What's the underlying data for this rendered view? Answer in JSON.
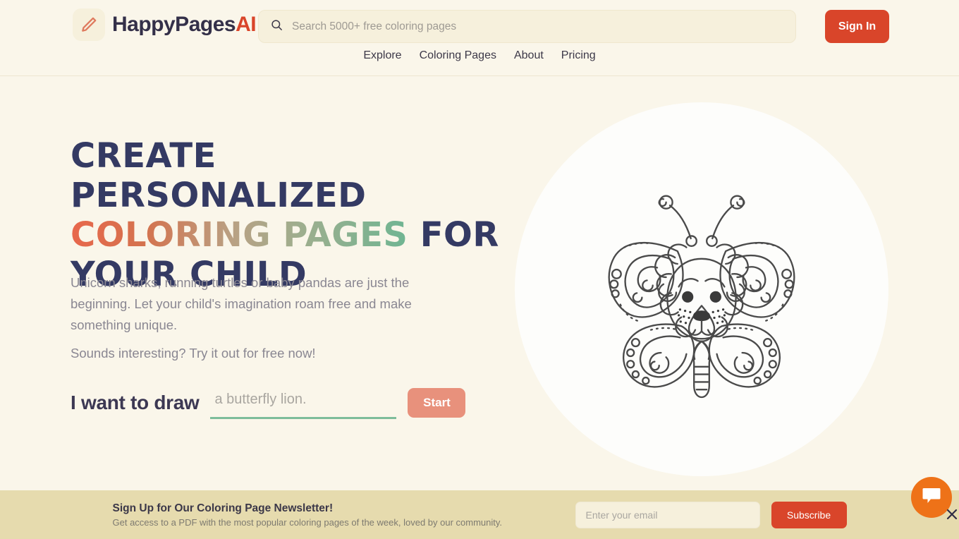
{
  "brand": {
    "name": "HappyPages",
    "suffix": "AI",
    "logo_icon": "pencil-icon"
  },
  "header": {
    "search": {
      "placeholder": "Search 5000+ free coloring pages",
      "value": "",
      "icon": "search-icon"
    },
    "signin_label": "Sign In",
    "nav": [
      {
        "label": "Explore"
      },
      {
        "label": "Coloring Pages"
      },
      {
        "label": "About"
      },
      {
        "label": "Pricing"
      }
    ]
  },
  "hero": {
    "headline_line1": "Create Personalized",
    "headline_gradient": "Coloring Pages",
    "headline_line2_tail": "for",
    "headline_line3": "Your Child",
    "lead": "Unicorn sharks, running turtles or baby pandas are just the beginning. Let your child's imagination roam free and make something unique.",
    "lead_2": "Sounds interesting? Try it out for free now!",
    "prompt_label": "I want to draw",
    "prompt_placeholder": "a butterfly lion.",
    "prompt_value": "",
    "start_label": "Start",
    "artwork_alt": "butterfly-lion-coloring-page"
  },
  "newsletter": {
    "title": "Sign Up for Our Coloring Page Newsletter!",
    "subtitle": "Get access to a PDF with the most popular coloring pages of the week, loved by our community.",
    "email_placeholder": "Enter your email",
    "email_value": "",
    "subscribe_label": "Subscribe"
  },
  "chat": {
    "fab_icon": "chat-bubble-icon",
    "close_icon": "close-icon"
  },
  "colors": {
    "page_bg": "#FAF6EA",
    "brand_red": "#D9452A",
    "start_salmon": "#E8917C",
    "underline_green": "#7EBD9B",
    "headline_navy": "#343A63",
    "newsletter_bg": "#E6DBAE",
    "chat_orange": "#EE7218"
  }
}
